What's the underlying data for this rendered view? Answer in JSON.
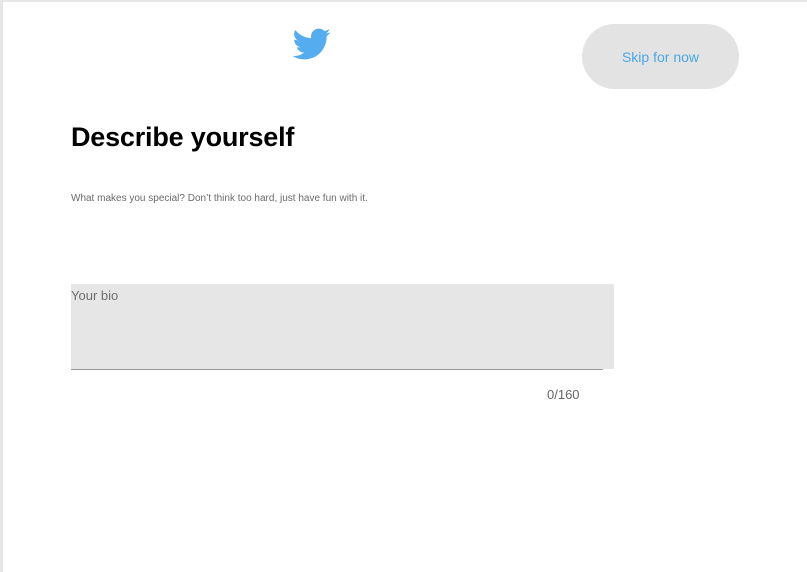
{
  "header": {
    "logo_icon": "twitter-bird-icon",
    "brand_color": "#55acee",
    "skip_label": "Skip for now"
  },
  "main": {
    "title": "Describe yourself",
    "subtitle": "What makes you special? Don’t think too hard, just have fun with it.",
    "bio": {
      "placeholder": "Your bio",
      "value": "",
      "counter": "0/160"
    }
  }
}
